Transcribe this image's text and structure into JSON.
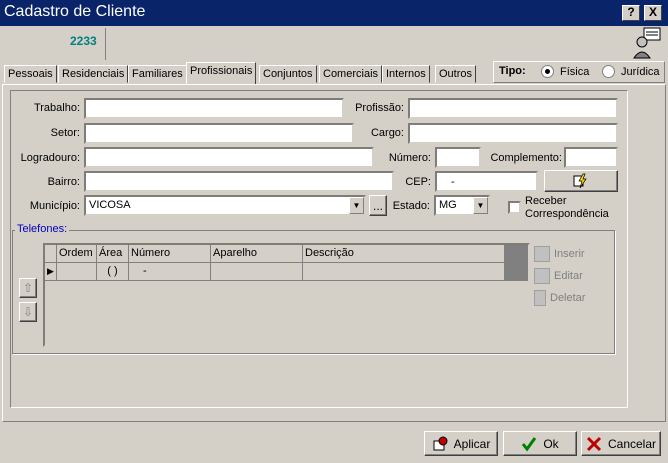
{
  "window": {
    "title": "Cadastro de Cliente",
    "help_btn": "?",
    "close_btn": "X"
  },
  "header": {
    "code": "2233"
  },
  "tabs": [
    "Pessoais",
    "Residenciais",
    "Familiares",
    "Profissionais",
    "Conjuntos",
    "Comerciais",
    "Internos",
    "Outros"
  ],
  "tipo": {
    "label": "Tipo:",
    "options": [
      "Física",
      "Jurídica"
    ],
    "selected": "Física"
  },
  "form": {
    "trabalho": {
      "label": "Trabalho:",
      "value": ""
    },
    "profissao": {
      "label": "Profissão:",
      "value": ""
    },
    "setor": {
      "label": "Setor:",
      "value": ""
    },
    "cargo": {
      "label": "Cargo:",
      "value": ""
    },
    "logradouro": {
      "label": "Logradouro:",
      "value": ""
    },
    "numero": {
      "label": "Número:",
      "value": ""
    },
    "complemento": {
      "label": "Complemento:",
      "value": ""
    },
    "bairro": {
      "label": "Bairro:",
      "value": ""
    },
    "cep": {
      "label": "CEP:",
      "value": "-"
    },
    "municipio": {
      "label": "Município:",
      "value": "VICOSA",
      "browse": "..."
    },
    "estado": {
      "label": "Estado:",
      "value": "MG"
    },
    "receber": {
      "label1": "Receber",
      "label2": "Correspondência",
      "checked": false
    }
  },
  "telefones": {
    "legend": "Telefones:",
    "columns": [
      "Ordem",
      "Área",
      "Número",
      "Aparelho",
      "Descrição"
    ],
    "row": {
      "ordem": "",
      "area": "( )",
      "numero": "-",
      "aparelho": "",
      "descricao": ""
    },
    "actions": {
      "inserir": "Inserir",
      "editar": "Editar",
      "deletar": "Deletar"
    }
  },
  "footer": {
    "aplicar": "Aplicar",
    "ok": "Ok",
    "cancelar": "Cancelar"
  },
  "icons": {
    "wizard": "user-wizard-icon",
    "cep_lookup": "lightning-search-icon",
    "up": "arrow-up-icon",
    "down": "arrow-down-icon"
  }
}
